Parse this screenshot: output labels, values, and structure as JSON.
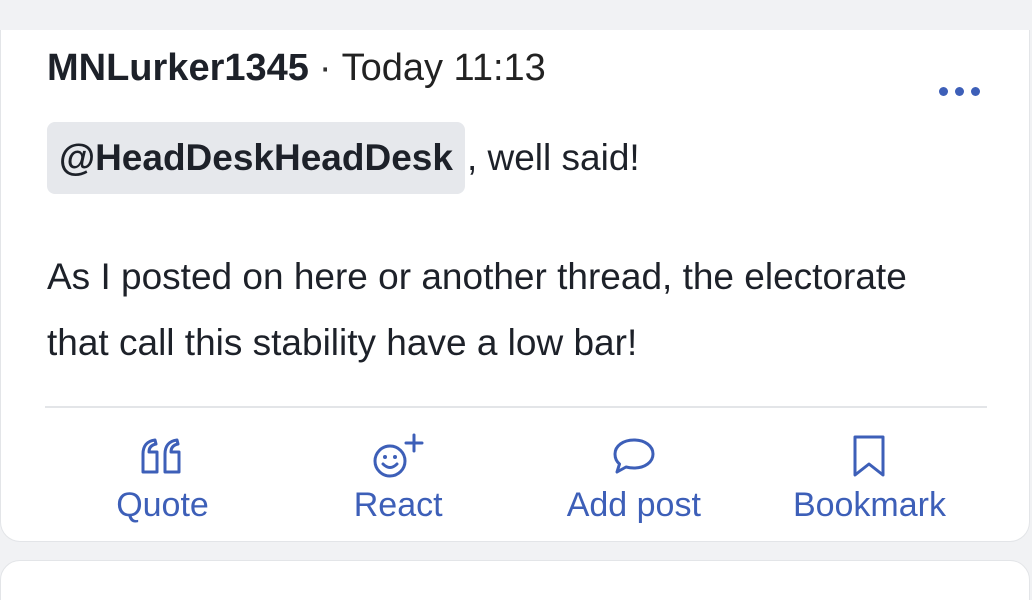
{
  "post": {
    "author": "MNLurker1345",
    "separator": "·",
    "timestamp": "Today 11:13",
    "mention": "@HeadDeskHeadDesk",
    "mention_suffix": ", well said!",
    "body": "As I posted on here or another thread, the electorate that call this stability have a low bar!"
  },
  "actions": [
    {
      "label": "Quote",
      "icon": "quote-icon"
    },
    {
      "label": "React",
      "icon": "react-smiley-icon"
    },
    {
      "label": "Add post",
      "icon": "speech-bubble-icon"
    },
    {
      "label": "Bookmark",
      "icon": "bookmark-icon"
    }
  ],
  "colors": {
    "accent": "#3d5fb8",
    "text": "#1d2129",
    "mention_bg": "#e6e8ec",
    "background": "#f1f2f4",
    "card": "#ffffff"
  }
}
